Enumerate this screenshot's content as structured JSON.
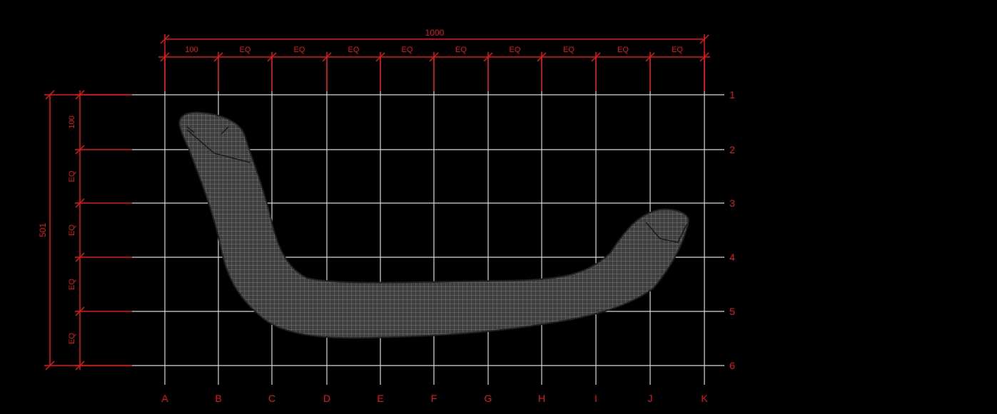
{
  "drawing": {
    "background": "#000000",
    "dimension_color": "#e01818",
    "grid_color": "#d8d8d8",
    "mesh_fill": "#4a4a4a",
    "mesh_line": "#9a9a9a",
    "horizontal_dimensions": {
      "overall": "1000",
      "segments": [
        "100",
        "EQ",
        "EQ",
        "EQ",
        "EQ",
        "EQ",
        "EQ",
        "EQ",
        "EQ",
        "EQ"
      ]
    },
    "vertical_dimensions": {
      "overall": "501",
      "segments": [
        "100",
        "EQ",
        "EQ",
        "EQ",
        "EQ"
      ]
    },
    "column_labels": [
      "A",
      "B",
      "C",
      "D",
      "E",
      "F",
      "G",
      "H",
      "I",
      "J",
      "K"
    ],
    "row_labels": [
      "1",
      "2",
      "3",
      "4",
      "5",
      "6"
    ],
    "object": {
      "description_icon": "curved-seat-mesh-icon"
    }
  }
}
